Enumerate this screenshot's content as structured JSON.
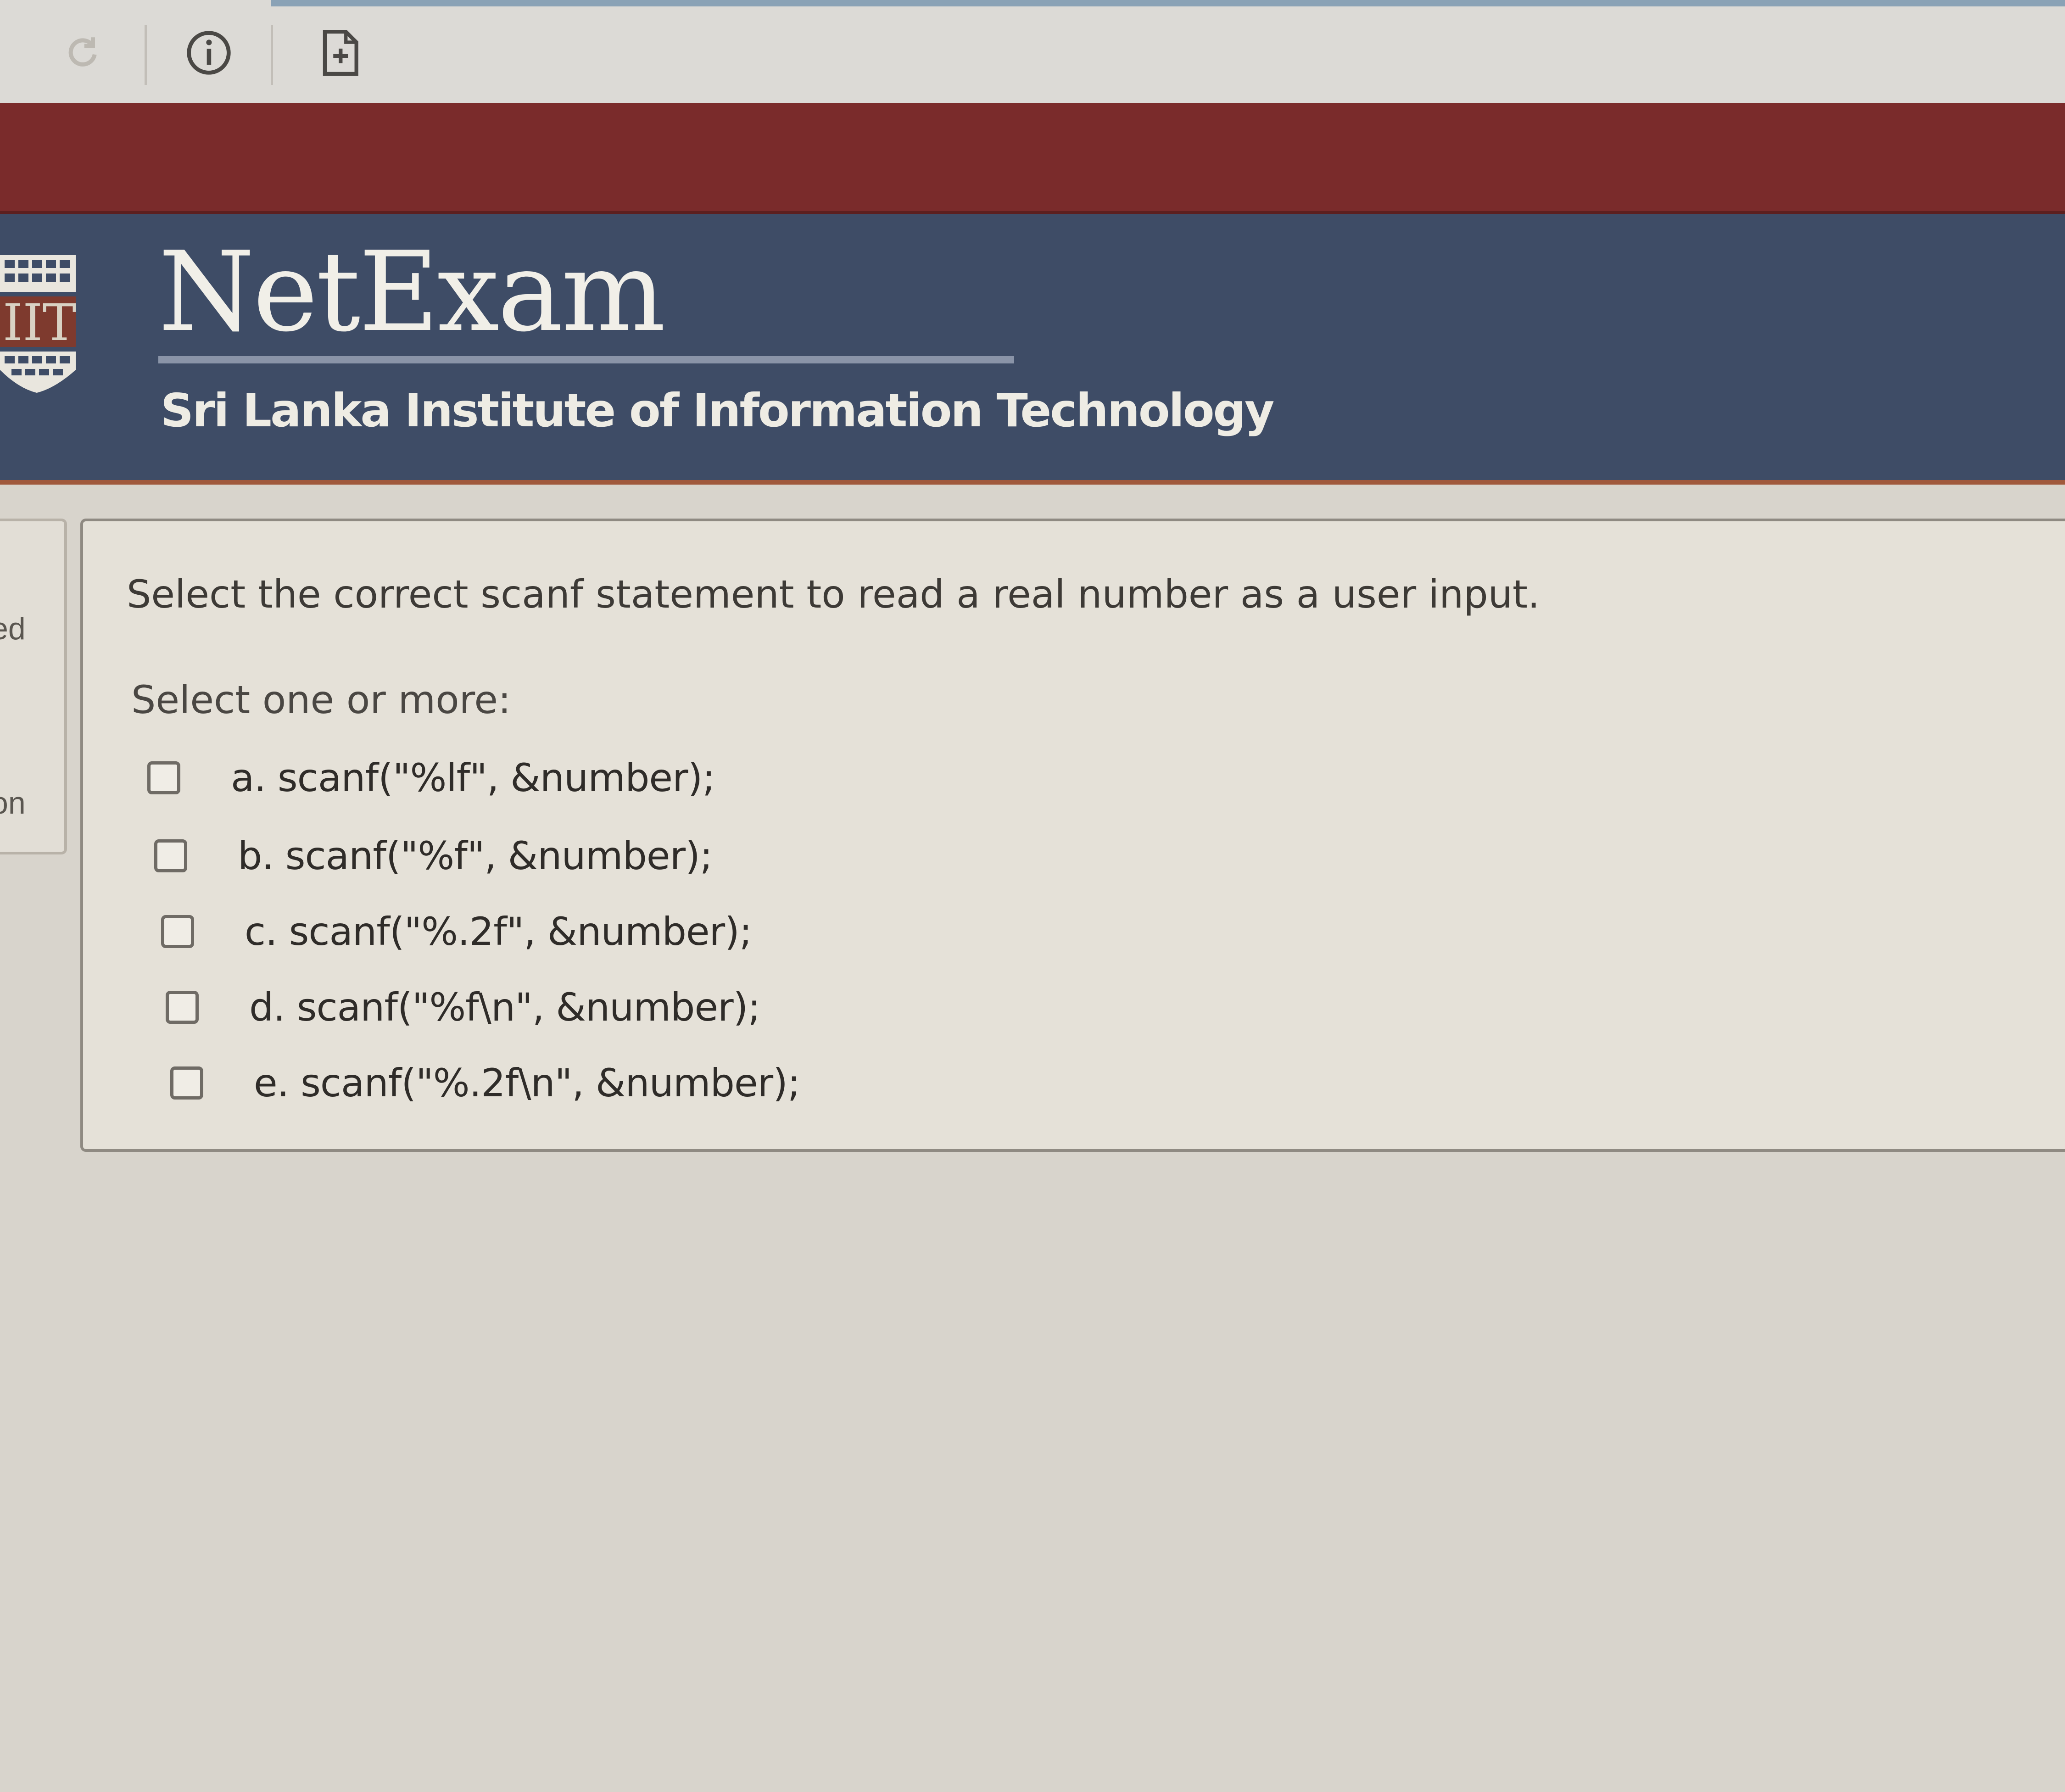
{
  "toolbar": {
    "icons": [
      "reload-icon",
      "info-icon",
      "document-add-icon"
    ]
  },
  "header": {
    "brand": "NetExam",
    "subtitle": "Sri Lanka Institute of Information Technology",
    "logo_text": "IIT"
  },
  "side_panel": {
    "label_top": "ed",
    "label_bottom": "on"
  },
  "question": {
    "text": "Select the correct scanf statement to read a real number as a user input.",
    "prompt": "Select one or more:",
    "options": [
      {
        "label": "a. scanf(\"%lf\", &number);",
        "checked": false
      },
      {
        "label": "b. scanf(\"%f\", &number);",
        "checked": false
      },
      {
        "label": "c. scanf(\"%.2f\", &number);",
        "checked": false
      },
      {
        "label": "d. scanf(\"%f\\n\", &number);",
        "checked": false
      },
      {
        "label": "e. scanf(\"%.2f\\n\", &number);",
        "checked": false
      }
    ]
  },
  "colors": {
    "maroon_band": "#7a2b2b",
    "header_bg": "#3e4c66",
    "header_accent": "#a0593c",
    "page_bg": "#d8d4cc",
    "card_bg": "#e5e1d8"
  }
}
